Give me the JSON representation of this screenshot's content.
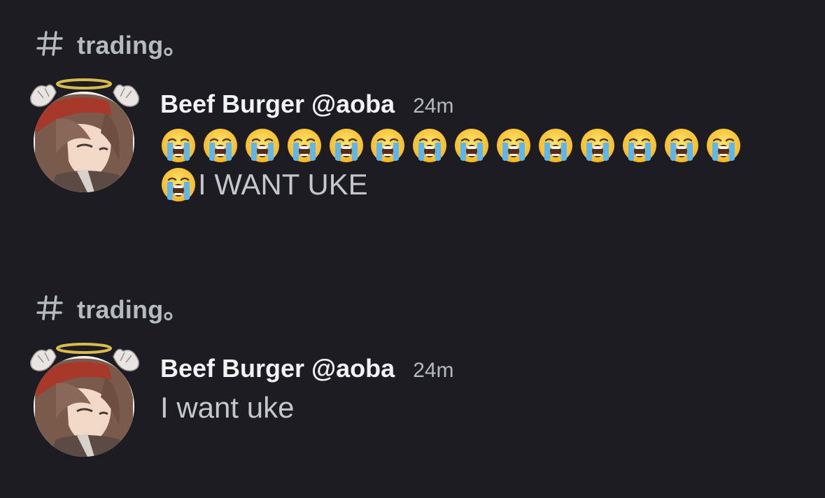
{
  "notifications": [
    {
      "channel": "trading。",
      "author": "Beef Burger @aoba",
      "time": "24m",
      "emoji_line_count": 14,
      "second_line_emoji_count": 1,
      "emoji": "loudly-crying-face",
      "text": "I WANT UKE"
    },
    {
      "channel": "trading。",
      "author": "Beef Burger @aoba",
      "time": "24m",
      "text": "I want uke"
    }
  ],
  "colors": {
    "background": "#1c1c22",
    "channel_text": "#b5bac1",
    "author_text": "#f2f3f5",
    "message_text": "#c4c7cc"
  },
  "icons": {
    "channel": "hash-icon",
    "avatar": "avatar",
    "emoji": "loudly-crying-face-icon"
  }
}
